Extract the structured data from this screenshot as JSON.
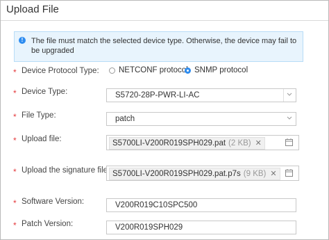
{
  "dialog": {
    "title": "Upload File"
  },
  "info": {
    "icon": "info-circle-icon",
    "message": "The file must match the selected device type. Otherwise, the device may fail to be upgraded"
  },
  "form": {
    "required_mark": "*",
    "protocol": {
      "label": "Device Protocol Type:",
      "options": [
        {
          "label": "NETCONF protocol",
          "selected": false
        },
        {
          "label": "SNMP protocol",
          "selected": true
        }
      ]
    },
    "device_type": {
      "label": "Device Type:",
      "value": "S5720-28P-PWR-LI-AC"
    },
    "file_type": {
      "label": "File Type:",
      "value": "patch"
    },
    "upload_file": {
      "label": "Upload file:",
      "file_name": "S5700LI-V200R019SPH029.pat",
      "file_size": "(2 KB)"
    },
    "signature_file": {
      "label": "Upload the signature file:",
      "file_name": "S5700LI-V200R019SPH029.pat.p7s",
      "file_size": "(9 KB)"
    },
    "software_version": {
      "label": "Software Version:",
      "value": "V200R019C10SPC500"
    },
    "patch_version": {
      "label": "Patch Version:",
      "value": "V200R019SPH029"
    }
  },
  "colors": {
    "accent": "#2d8cf0",
    "required": "#e4393c",
    "info_bg": "#e8f4fd"
  }
}
